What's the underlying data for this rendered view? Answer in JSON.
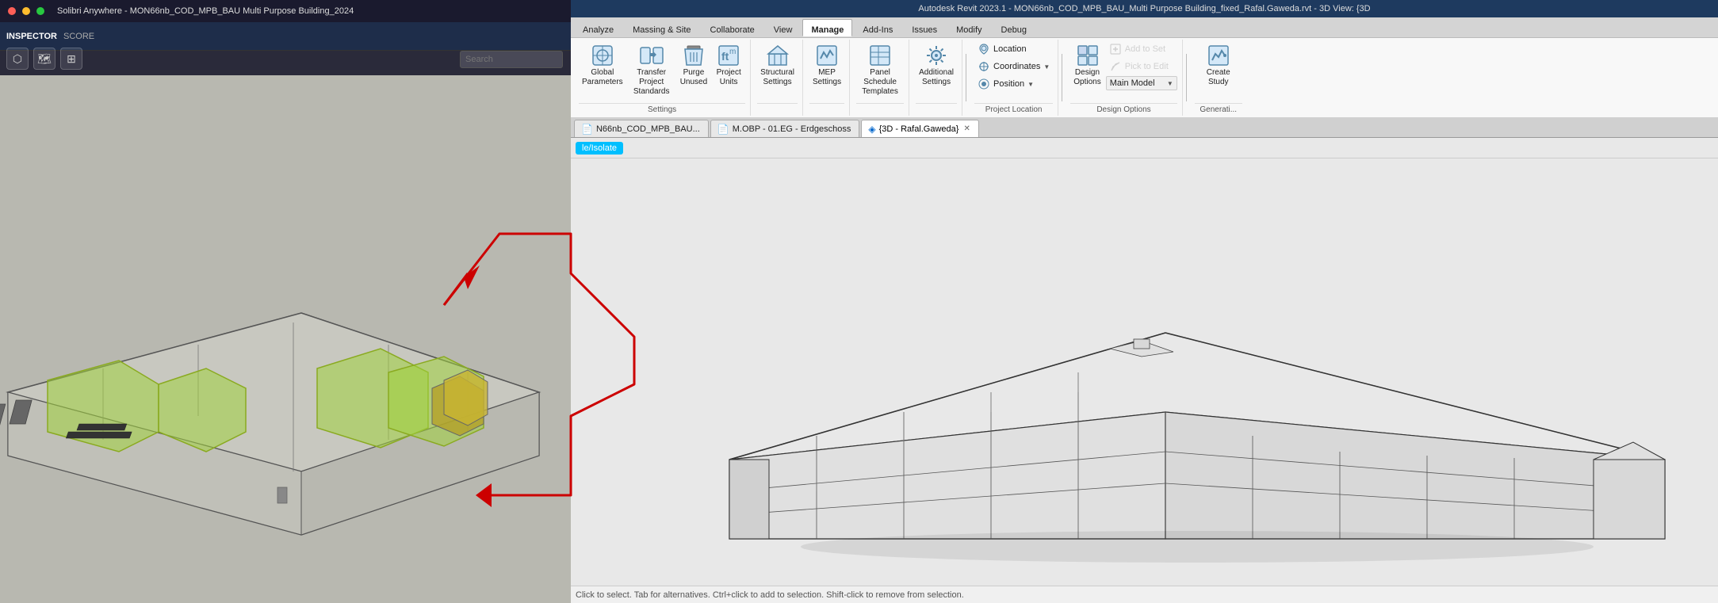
{
  "title_bar": {
    "text": "Autodesk Revit 2023.1 - MON66nb_COD_MPB_BAU_Multi Purpose Building_fixed_Rafal.Gaweda.rvt - 3D View: {3D"
  },
  "solibri_title": "Solibri Anywhere - MON66nb_COD_MPB_BAU Multi Purpose Building_2024",
  "ribbon": {
    "tabs": [
      {
        "label": "Analyze",
        "active": false
      },
      {
        "label": "Massing & Site",
        "active": false
      },
      {
        "label": "Collaborate",
        "active": false
      },
      {
        "label": "View",
        "active": false
      },
      {
        "label": "Manage",
        "active": true
      },
      {
        "label": "Add-Ins",
        "active": false
      },
      {
        "label": "Issues",
        "active": false
      },
      {
        "label": "Modify",
        "active": false
      },
      {
        "label": "Debug",
        "active": false
      }
    ],
    "groups": {
      "settings": {
        "label": "Settings",
        "buttons": [
          {
            "id": "global-parameters",
            "icon": "⚙",
            "label": "Global\nParameters"
          },
          {
            "id": "transfer-project-standards",
            "icon": "⇄",
            "label": "Transfer\nProject Standards"
          },
          {
            "id": "purge-unused",
            "icon": "🗑",
            "label": "Purge\nUnused"
          },
          {
            "id": "project-units",
            "icon": "📐",
            "label": "Project\nUnits"
          }
        ]
      },
      "structural": {
        "label": "",
        "buttons": [
          {
            "id": "structural-settings",
            "icon": "🏗",
            "label": "Structural\nSettings"
          }
        ]
      },
      "mep": {
        "label": "",
        "buttons": [
          {
            "id": "mep-settings",
            "icon": "⚡",
            "label": "MEP\nSettings"
          }
        ]
      },
      "panel_schedule": {
        "label": "",
        "buttons": [
          {
            "id": "panel-schedule-templates",
            "icon": "📋",
            "label": "Panel Schedule\nTemplates"
          }
        ]
      },
      "additional": {
        "label": "",
        "buttons": [
          {
            "id": "additional-settings",
            "icon": "⚙",
            "label": "Additional\nSettings"
          }
        ]
      },
      "project_location": {
        "label": "Project Location",
        "items": [
          {
            "id": "location",
            "icon": "📍",
            "label": "Location"
          },
          {
            "id": "coordinates",
            "icon": "🌐",
            "label": "Coordinates"
          },
          {
            "id": "position",
            "icon": "📌",
            "label": "Position"
          }
        ]
      },
      "design_options": {
        "label": "Design Options",
        "items": [
          {
            "id": "design-options",
            "icon": "🎨",
            "label": "Design\nOptions"
          },
          {
            "id": "add-to-set",
            "icon": "➕",
            "label": "Add to Set"
          },
          {
            "id": "pick-to-edit",
            "icon": "✏",
            "label": "Pick to Edit"
          },
          {
            "id": "main-model-dropdown",
            "icon": "▼",
            "label": "Main Model"
          }
        ]
      },
      "create_study": {
        "label": "Generati...",
        "items": [
          {
            "id": "create-study",
            "icon": "📊",
            "label": "Create\nStudy"
          }
        ]
      }
    }
  },
  "window_tabs": [
    {
      "id": "tab-cod",
      "icon": "📄",
      "label": "N66nb_COD_MPB_BAU...",
      "closeable": false,
      "active": false
    },
    {
      "id": "tab-mobp",
      "icon": "📄",
      "label": "M.OBP - 01.EG - Erdgeschoss",
      "closeable": false,
      "active": false
    },
    {
      "id": "tab-3d",
      "icon": "🔷",
      "label": "{3D - Rafal.Gaweda}",
      "closeable": true,
      "active": true
    }
  ],
  "view_toolbar": {
    "highlight_label": "le/Isolate"
  },
  "left_nav": {
    "title": "INSPECTOR",
    "subtitle": "SCORE",
    "search_placeholder": "Search"
  },
  "left_icons": [
    {
      "id": "icon1",
      "symbol": "⬡"
    },
    {
      "id": "icon2",
      "symbol": "🗺"
    },
    {
      "id": "icon3",
      "symbol": "⊞"
    }
  ],
  "colors": {
    "revit_bg": "#e8e8e8",
    "solibri_bg": "#b0b0a8",
    "building_outline": "#333333",
    "building_highlight": "rgba(180,220,80,0.6)",
    "ribbon_active_tab": "#ffffff",
    "ribbon_bg": "#f8f8f8",
    "connector_red": "#cc0000"
  }
}
